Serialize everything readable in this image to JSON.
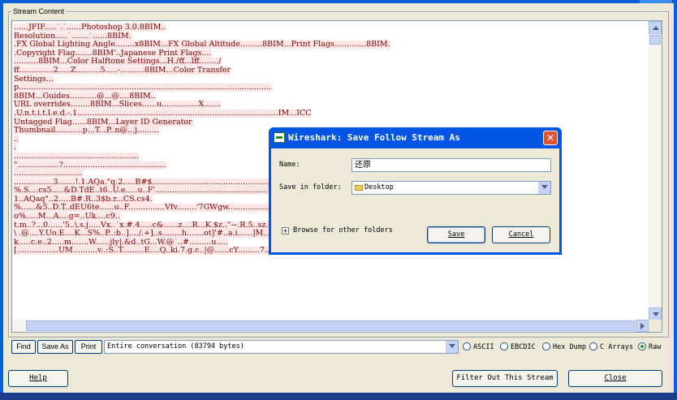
{
  "group_label": "Stream Content",
  "stream_lines": [
    "......JFIF.....`.`......Photoshop 3.0.8BIM..",
    "Resolution.....`.......`......8BIM.",
    ".FX Global Lighting Angle........x8BIM...FX Global Altitude.........8BIM...Print Flags.............8BIM.",
    ".Copyright Flag.......8BIM'..Japanese Print Flags....",
    "..........8BIM...Color Halftone Settings...H./ff...lff......../",
    "ff..............2.....Z..........5.....-..........8BIM...Color Transfer",
    "Settings...",
    "p.......................................................................................................",
    "8BIM...Guides...........@...@....8BIM..",
    "URL overrides........8BIM...Slices......u...............X.......",
    ".U.n.t.i.t.l.e.d.-.1..................................................................................IM...ICC",
    "Untagged Flag......8BIM...Layer ID Generator",
    "Thumbnail...........p...T...P..n@...j.........",
    "..",
    ".",
    "...................................................",
    "\".................?..........................................",
    "............................",
    "................3.......!.1.AQa.\"q.2.....B#$.......................................................!",
    "%.S....cs5.....&D.TdE..t6..U.e.....u..F'..........................................................!",
    "1..AQaq\"..2.....B#.R..3$b.r...CS.cs4.",
    "%......&5..D.T..dEU6te......u..F...............Vfv........'7GWgw..................?....t.....e..\"..}.m<..7......r.",
    "o%.....M...A....g=..Uk....c9..",
    "t.m..?...0......'5..\\.s.j.....Vx..`x.#.4.....c&......z....R...K.$z..\"~.R.5..sz.P.[m....Z.k.j?.6=..Mw.j..",
    "\\ .@....Y.Uo.E....K...S%..P..:b..]..../.+]..s........h.......ot]'#..a.i......]M.....>.....:......0.u..p.....?",
    "k.....c.e..2.....m.......W......jly|.&d..tG...W.@`..#.........u.....",
    "[.................UM..........v..:S..T.........E....Q..ki.7.g.c..|@......cY.........7...1:.....`.GX.-...7......Y..{2p...."
  ],
  "toolbar": {
    "find": "Find",
    "save_as": "Save As",
    "print": "Print",
    "conversation": "Entire conversation (83794 bytes)"
  },
  "formats": [
    "ASCII",
    "EBCDIC",
    "Hex Dump",
    "C Arrays",
    "Raw"
  ],
  "selected_format": "Raw",
  "bottom": {
    "help": "Help",
    "filter_out": "Filter Out This Stream",
    "close": "Close"
  },
  "dialog": {
    "title": "Wireshark: Save Follow Stream As",
    "name_label": "Name:",
    "name_value": "还原",
    "folder_label": "Save in folder:",
    "folder_value": "Desktop",
    "browse_label": "Browse for other folders",
    "save": "Save",
    "cancel": "Cancel"
  },
  "colors": {
    "stream_bg": "#fde6e6",
    "stream_fg": "#7a0000",
    "title_bar": "#0055e5",
    "close_button": "#e0532e"
  },
  "icons": [
    "wireshark-icon",
    "close-icon",
    "folder-icon",
    "expander-plus-icon",
    "chevron-down-icon"
  ]
}
